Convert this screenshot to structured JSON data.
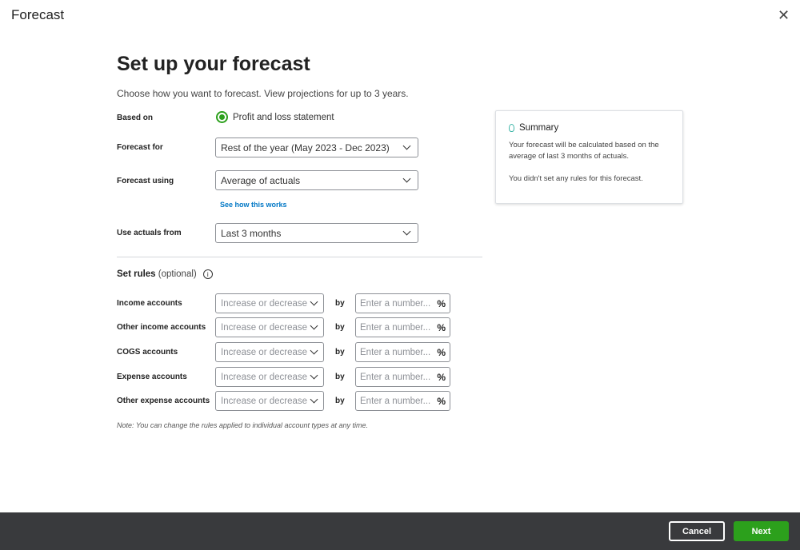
{
  "window": {
    "title": "Forecast"
  },
  "heading": "Set up your forecast",
  "subtitle": "Choose how you want to forecast. View projections for up to 3 years.",
  "based_on": {
    "label": "Based on",
    "option": "Profit and loss statement"
  },
  "forecast_for": {
    "label": "Forecast for",
    "value": "Rest of the year (May 2023 - Dec 2023)"
  },
  "forecast_using": {
    "label": "Forecast using",
    "value": "Average of actuals",
    "link": "See how this works"
  },
  "use_actuals": {
    "label": "Use actuals from",
    "value": "Last 3 months"
  },
  "rules": {
    "title": "Set rules",
    "optional": "(optional)",
    "by": "by",
    "select_placeholder": "Increase or decrease",
    "number_placeholder": "Enter a number...",
    "percent": "%",
    "rows": [
      {
        "label": "Income accounts"
      },
      {
        "label": "Other income accounts"
      },
      {
        "label": "COGS accounts"
      },
      {
        "label": "Expense accounts"
      },
      {
        "label": "Other expense accounts"
      }
    ],
    "note": "Note: You can change the rules applied to individual account types at any time."
  },
  "summary": {
    "title": "Summary",
    "line1": "Your forecast will be calculated based on the average of last 3 months of actuals.",
    "line2": "You didn't set any rules for this forecast."
  },
  "footer": {
    "cancel": "Cancel",
    "next": "Next"
  },
  "colors": {
    "accent": "#2ca01c",
    "link": "#0077c5",
    "footer": "#393a3d"
  }
}
